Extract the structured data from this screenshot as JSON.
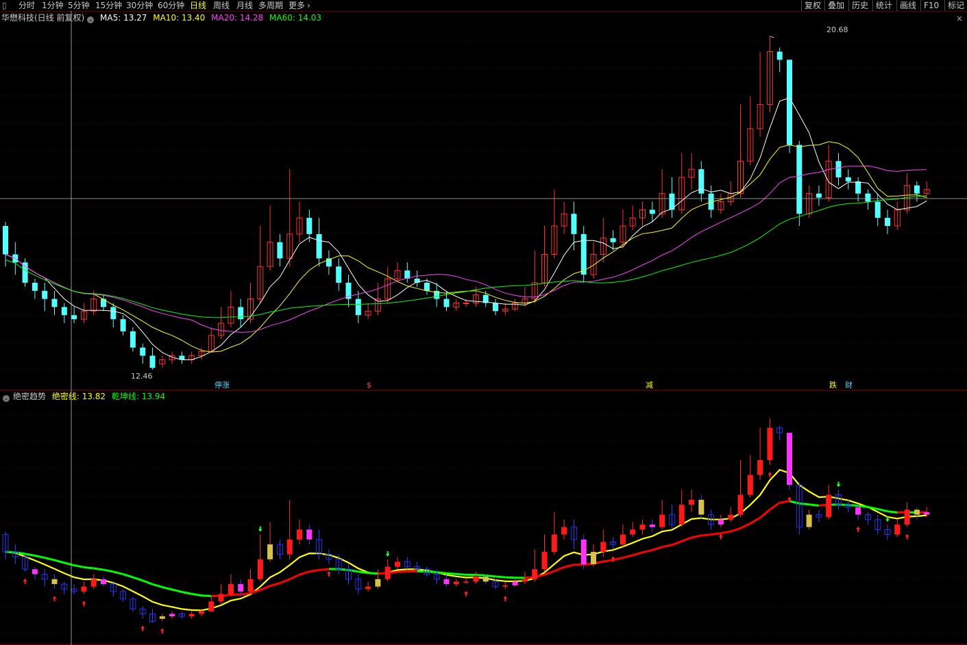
{
  "toolbar": {
    "periods": [
      "分时",
      "1分钟",
      "5分钟",
      "15分钟",
      "30分钟",
      "60分钟",
      "日线",
      "周线",
      "月线",
      "多周期",
      "更多"
    ],
    "active_period": "日线",
    "right_buttons": [
      "复权",
      "叠加",
      "历史",
      "统计",
      "画线",
      "F10",
      "标记"
    ]
  },
  "main_legend": {
    "title": "华懋科技(日线 前复权)",
    "ma5": "MA5: 13.27",
    "ma10": "MA10: 13.40",
    "ma20": "MA20: 14.28",
    "ma60": "MA60: 14.03"
  },
  "sub_legend": {
    "title": "绝密趋势",
    "line1": "绝密线: 13.82",
    "line2": "乾坤线: 13.94"
  },
  "labels": {
    "high": "20.68",
    "low": "12.46",
    "markers": [
      "停涨",
      "$",
      "减",
      "跌",
      "财"
    ]
  },
  "colors": {
    "up": "#ff3030",
    "down": "#54ffff",
    "ma5": "#ffffff",
    "ma10": "#ffff00",
    "ma20": "#ff40ff",
    "ma60": "#00ff00",
    "trend_yellow": "#ffff00",
    "trend_red": "#ff0000",
    "trend_green": "#00ff00"
  },
  "chart_data": {
    "type": "candlestick",
    "y_range": [
      12.2,
      21.0
    ],
    "highest": 20.68,
    "lowest": 12.46,
    "candles": [
      [
        16.0,
        15.3,
        16.1,
        15.0
      ],
      [
        15.3,
        15.1,
        15.6,
        14.8
      ],
      [
        15.1,
        14.6,
        15.2,
        14.5
      ],
      [
        14.6,
        14.4,
        14.7,
        14.2
      ],
      [
        14.4,
        14.2,
        14.6,
        13.9
      ],
      [
        14.2,
        14.0,
        14.4,
        13.8
      ],
      [
        14.0,
        13.8,
        14.1,
        13.6
      ],
      [
        13.8,
        13.7,
        14.0,
        13.6
      ],
      [
        13.7,
        13.9,
        14.1,
        13.6
      ],
      [
        13.9,
        14.2,
        14.4,
        13.8
      ],
      [
        14.2,
        14.0,
        14.3,
        13.9
      ],
      [
        14.0,
        13.7,
        14.1,
        13.5
      ],
      [
        13.7,
        13.4,
        13.8,
        13.3
      ],
      [
        13.4,
        13.0,
        13.5,
        12.9
      ],
      [
        13.0,
        12.8,
        13.1,
        12.6
      ],
      [
        12.8,
        12.5,
        13.0,
        12.46
      ],
      [
        12.6,
        12.7,
        12.8,
        12.5
      ],
      [
        12.7,
        12.8,
        12.9,
        12.6
      ],
      [
        12.8,
        12.7,
        12.9,
        12.6
      ],
      [
        12.7,
        12.8,
        12.9,
        12.6
      ],
      [
        12.8,
        12.9,
        13.0,
        12.7
      ],
      [
        12.9,
        13.3,
        13.5,
        12.9
      ],
      [
        13.3,
        13.6,
        14.0,
        13.2
      ],
      [
        13.6,
        14.0,
        14.4,
        13.5
      ],
      [
        14.0,
        13.7,
        14.2,
        13.5
      ],
      [
        13.7,
        14.2,
        14.6,
        13.6
      ],
      [
        14.2,
        15.0,
        16.0,
        14.1
      ],
      [
        15.0,
        15.6,
        16.5,
        14.9
      ],
      [
        15.6,
        15.2,
        15.8,
        15.0
      ],
      [
        15.2,
        15.8,
        17.4,
        15.0
      ],
      [
        15.8,
        16.2,
        16.6,
        15.6
      ],
      [
        16.2,
        15.8,
        16.4,
        15.6
      ],
      [
        15.8,
        15.2,
        16.2,
        15.0
      ],
      [
        15.2,
        15.0,
        15.4,
        14.8
      ],
      [
        15.0,
        14.6,
        15.2,
        14.4
      ],
      [
        14.6,
        14.2,
        14.8,
        14.0
      ],
      [
        14.2,
        13.8,
        14.4,
        13.6
      ],
      [
        13.8,
        13.9,
        14.1,
        13.7
      ],
      [
        13.9,
        14.2,
        14.6,
        13.8
      ],
      [
        14.2,
        14.7,
        15.0,
        14.1
      ],
      [
        14.7,
        14.9,
        15.1,
        14.6
      ],
      [
        14.9,
        14.7,
        15.1,
        14.6
      ],
      [
        14.7,
        14.6,
        14.9,
        14.5
      ],
      [
        14.6,
        14.4,
        14.7,
        14.3
      ],
      [
        14.4,
        14.2,
        14.6,
        14.0
      ],
      [
        14.2,
        14.0,
        14.4,
        13.9
      ],
      [
        14.0,
        14.1,
        14.2,
        13.9
      ],
      [
        14.1,
        14.1,
        14.2,
        14.0
      ],
      [
        14.1,
        14.3,
        14.5,
        14.0
      ],
      [
        14.3,
        14.1,
        14.4,
        14.0
      ],
      [
        14.1,
        13.9,
        14.2,
        13.8
      ],
      [
        13.9,
        13.95,
        14.1,
        13.8
      ],
      [
        13.95,
        14.1,
        14.2,
        13.9
      ],
      [
        14.1,
        14.2,
        14.5,
        14.0
      ],
      [
        14.2,
        14.6,
        15.4,
        14.1
      ],
      [
        14.6,
        15.3,
        16.0,
        14.5
      ],
      [
        15.3,
        16.0,
        16.9,
        15.2
      ],
      [
        16.0,
        16.3,
        16.6,
        15.8
      ],
      [
        16.3,
        15.8,
        16.6,
        15.4
      ],
      [
        15.8,
        14.8,
        16.0,
        14.6
      ],
      [
        14.8,
        15.3,
        15.6,
        14.7
      ],
      [
        15.3,
        15.7,
        16.2,
        15.1
      ],
      [
        15.7,
        15.6,
        15.9,
        15.4
      ],
      [
        15.6,
        16.0,
        16.4,
        15.5
      ],
      [
        16.0,
        16.2,
        16.5,
        15.9
      ],
      [
        16.2,
        16.4,
        16.6,
        16.0
      ],
      [
        16.4,
        16.3,
        16.6,
        16.1
      ],
      [
        16.3,
        16.8,
        17.4,
        16.2
      ],
      [
        16.8,
        16.4,
        17.2,
        16.2
      ],
      [
        16.4,
        17.2,
        17.8,
        16.3
      ],
      [
        17.2,
        17.4,
        17.8,
        16.9
      ],
      [
        17.4,
        16.8,
        17.6,
        16.6
      ],
      [
        16.8,
        16.4,
        17.0,
        16.2
      ],
      [
        16.4,
        16.6,
        16.8,
        16.3
      ],
      [
        16.6,
        16.8,
        17.1,
        16.5
      ],
      [
        16.8,
        17.6,
        19.0,
        16.7
      ],
      [
        17.6,
        18.4,
        19.2,
        17.5
      ],
      [
        18.4,
        19.0,
        20.3,
        18.2
      ],
      [
        19.0,
        20.3,
        20.68,
        18.8
      ],
      [
        20.3,
        20.1,
        20.4,
        19.8
      ],
      [
        20.1,
        18.0,
        20.1,
        17.8
      ],
      [
        18.0,
        16.3,
        18.1,
        16.0
      ],
      [
        16.3,
        16.8,
        17.0,
        16.2
      ],
      [
        16.8,
        16.7,
        17.0,
        16.5
      ],
      [
        16.7,
        17.6,
        18.0,
        16.6
      ],
      [
        17.6,
        17.2,
        17.8,
        17.0
      ],
      [
        17.2,
        17.1,
        17.4,
        16.9
      ],
      [
        17.1,
        16.8,
        17.2,
        16.6
      ],
      [
        16.8,
        16.6,
        16.9,
        16.4
      ],
      [
        16.6,
        16.2,
        16.8,
        16.0
      ],
      [
        16.2,
        16.0,
        16.4,
        15.8
      ],
      [
        16.0,
        16.4,
        16.6,
        15.9
      ],
      [
        16.4,
        17.0,
        17.3,
        16.3
      ],
      [
        17.0,
        16.8,
        17.1,
        16.6
      ],
      [
        16.8,
        16.9,
        17.1,
        16.7
      ]
    ]
  }
}
